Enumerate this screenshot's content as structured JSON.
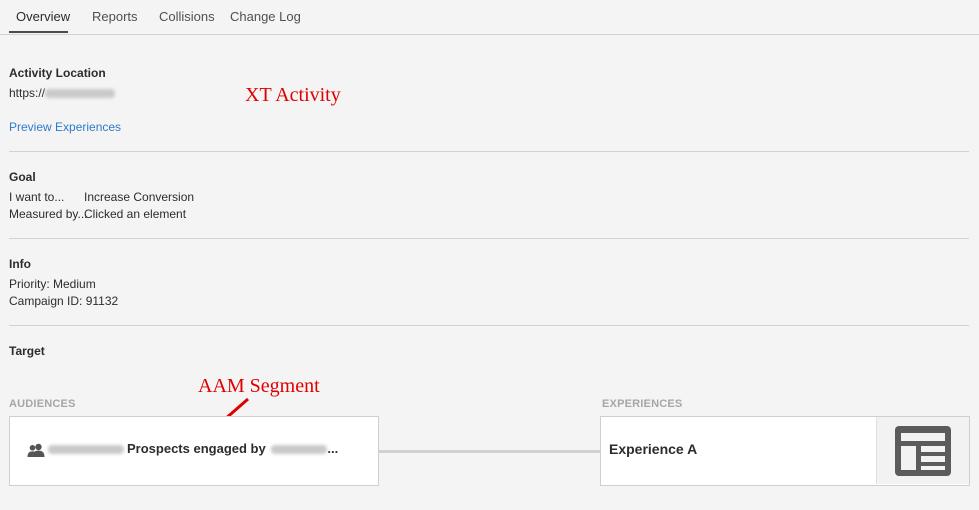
{
  "tabs": [
    {
      "label": "Overview",
      "active": true
    },
    {
      "label": "Reports",
      "active": false
    },
    {
      "label": "Collisions",
      "active": false
    },
    {
      "label": "Change Log",
      "active": false
    }
  ],
  "activity_location": {
    "title": "Activity Location",
    "url_prefix": "https://",
    "preview_link": "Preview Experiences"
  },
  "goal": {
    "title": "Goal",
    "want_label": "I want to...",
    "want_value": "Increase Conversion",
    "measured_label": "Measured by...",
    "measured_value": "Clicked an element"
  },
  "info": {
    "title": "Info",
    "priority": "Priority: Medium",
    "campaign": "Campaign ID: 91132"
  },
  "target": {
    "title": "Target",
    "audiences_label": "AUDIENCES",
    "experiences_label": "EXPERIENCES",
    "audience_text": "Prospects engaged by",
    "audience_ellipsis": "...",
    "experience_name": "Experience A"
  },
  "annotations": {
    "xt_activity": "XT Activity",
    "aam_segment": "AAM Segment"
  },
  "icons": {
    "audience": "users-icon",
    "experience": "layout-template-icon",
    "annotation_arrow": "red-arrow-icon"
  },
  "colors": {
    "link": "#2d7acd",
    "annotation": "#e00000"
  }
}
